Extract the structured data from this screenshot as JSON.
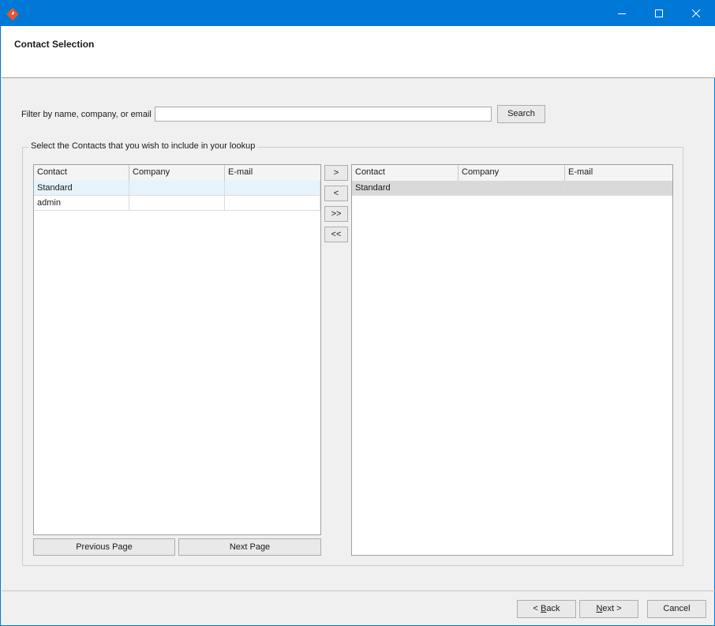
{
  "window": {
    "icon": "app-diamond-icon",
    "controls": {
      "minimize": "minimize-icon",
      "maximize": "maximize-icon",
      "close": "close-icon"
    },
    "accent": "#0078d7"
  },
  "header": {
    "title": "Contact Selection"
  },
  "filter": {
    "label": "Filter by name, company, or email",
    "value": "",
    "search_label": "Search"
  },
  "group": {
    "label": "Select the Contacts that you wish to include in your lookup"
  },
  "available": {
    "columns": [
      "Contact",
      "Company",
      "E-mail"
    ],
    "rows": [
      {
        "contact": "Standard",
        "company": "",
        "email": ""
      },
      {
        "contact": "admin",
        "company": "",
        "email": ""
      }
    ],
    "selected_row_color": "#e5f3fb"
  },
  "transfer": {
    "add": ">",
    "remove": "<",
    "add_all": ">>",
    "remove_all": "<<"
  },
  "paging": {
    "previous": "Previous Page",
    "next": "Next Page"
  },
  "selected": {
    "columns": [
      "Contact",
      "Company",
      "E-mail"
    ],
    "rows": [
      {
        "contact": "Standard",
        "company": "",
        "email": ""
      }
    ],
    "selected_row_color": "#d9d9d9"
  },
  "footer": {
    "back_mnemonic": "B",
    "back_rest": "ack",
    "back_prefix": "< ",
    "next_mnemonic": "N",
    "next_rest": "ext >",
    "cancel": "Cancel"
  }
}
